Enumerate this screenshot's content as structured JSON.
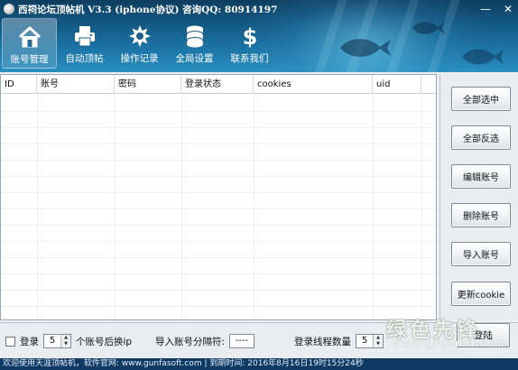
{
  "window": {
    "title": "西祠论坛顶帖机 V3.3 (iphone协议) 咨询QQ: 80914197",
    "minimize": "—",
    "close": "✕"
  },
  "toolbar": {
    "items": [
      {
        "label": "账号管理",
        "icon": "house-icon",
        "active": true
      },
      {
        "label": "自动顶帖",
        "icon": "printer-icon",
        "active": false
      },
      {
        "label": "操作记录",
        "icon": "gear-burst-icon",
        "active": false
      },
      {
        "label": "全局设置",
        "icon": "database-stack-icon",
        "active": false
      },
      {
        "label": "联系我们",
        "icon": "dollar-icon",
        "active": false
      }
    ]
  },
  "table": {
    "columns": [
      "ID",
      "账号",
      "密码",
      "登录状态",
      "cookies",
      "uid"
    ],
    "rows": []
  },
  "side_buttons": {
    "select_all": "全部选中",
    "invert_select": "全部反选",
    "edit_account": "编辑账号",
    "delete_account": "删除账号",
    "import_account": "导入账号",
    "update_cookie": "更新cookie"
  },
  "options": {
    "login_label": "登录",
    "accounts_value": "5",
    "switch_ip_label": "个账号后换ip",
    "import_sep_label": "导入账号分隔符:",
    "import_sep_value": "----",
    "thread_label": "登录线程数量",
    "thread_value": "5",
    "login_button": "登陆"
  },
  "watermark": {
    "text": "绿色先锋",
    "site": "www.greenxf.com"
  },
  "status": {
    "text": "欢迎使用天涯顶帖机，软件官网: www.gunfasoft.com  | 到期时间: 2016年8月16日19时15分24秒"
  },
  "colors": {
    "header": "#145a86",
    "status_bar": "#0f3a64"
  }
}
